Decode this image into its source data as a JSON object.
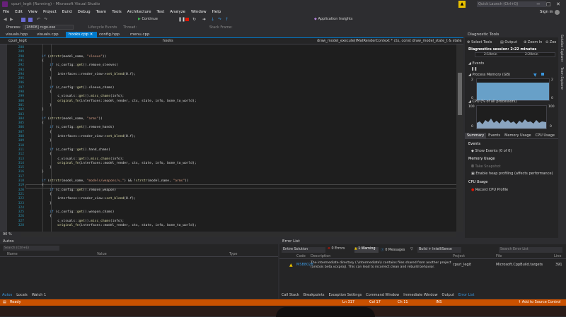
{
  "window": {
    "title": "cpuri_legit (Running) - Microsoft Visual Studio",
    "quick_launch": "Quick Launch (Ctrl+Q)",
    "sign_in": "Sign in"
  },
  "menu": [
    "File",
    "Edit",
    "View",
    "Project",
    "Build",
    "Debug",
    "Team",
    "Tools",
    "Architecture",
    "Test",
    "Analyze",
    "Window",
    "Help"
  ],
  "toolbar": {
    "continue_label": "Continue",
    "app_insights": "Application Insights",
    "process_label": "Process:",
    "process_value": "[18808] csgo.exe",
    "lifecycle_label": "Lifecycle Events",
    "thread_label": "Thread:",
    "stack_label": "Stack Frame:"
  },
  "tabs": [
    {
      "label": "visuals.hpp"
    },
    {
      "label": "visuals.cpp"
    },
    {
      "label": "hooks.cpp",
      "active": true
    },
    {
      "label": "config.hpp"
    },
    {
      "label": "menu.cpp"
    }
  ],
  "navbar": {
    "project": "cpuri_legit",
    "scope": "hooks",
    "function": "draw_model_execute(IMatRenderContext * ctx, const draw_model_state_t & state, const model_render_info_t & info, matrix3x4_t * matrix)"
  },
  "code_lines": [
    {
      "n": "288",
      "t": ""
    },
    {
      "n": "289",
      "t": ""
    },
    {
      "n": "290",
      "t": "    if (strstr(model_name, \"sleeve\"))"
    },
    {
      "n": "291",
      "t": "    {"
    },
    {
      "n": "292",
      "t": "        if (c_config::get().remove_sleeves)"
    },
    {
      "n": "293",
      "t": "        {"
    },
    {
      "n": "294",
      "t": "            interfaces::render_view->set_blend(0.f);"
    },
    {
      "n": "295",
      "t": "        }"
    },
    {
      "n": "296",
      "t": ""
    },
    {
      "n": "297",
      "t": "        if (c_config::get().sleeve_chams)"
    },
    {
      "n": "298",
      "t": "        {"
    },
    {
      "n": "299",
      "t": "            c_visuals::get().misc_chams(info);"
    },
    {
      "n": "300",
      "t": "            original_fn(interfaces::model_render, ctx, state, info, bone_to_world);"
    },
    {
      "n": "301",
      "t": "        }"
    },
    {
      "n": "302",
      "t": "    }"
    },
    {
      "n": "303",
      "t": ""
    },
    {
      "n": "304",
      "t": "    if (strstr(model_name, \"arms\"))"
    },
    {
      "n": "305",
      "t": "    {"
    },
    {
      "n": "306",
      "t": "        if (c_config::get().remove_hands)"
    },
    {
      "n": "307",
      "t": "        {"
    },
    {
      "n": "308",
      "t": "            interfaces::render_view->set_blend(0.f);"
    },
    {
      "n": "309",
      "t": "        }"
    },
    {
      "n": "310",
      "t": ""
    },
    {
      "n": "311",
      "t": "        if (c_config::get().hand_chams)"
    },
    {
      "n": "312",
      "t": "        {"
    },
    {
      "n": "313",
      "t": "            c_visuals::get().misc_chams(info);"
    },
    {
      "n": "314",
      "t": "            original_fn(interfaces::model_render, ctx, state, info, bone_to_world);"
    },
    {
      "n": "315",
      "t": "        }"
    },
    {
      "n": "316",
      "t": "    }"
    },
    {
      "n": "317",
      "t": ""
    },
    {
      "n": "318",
      "t": "    if (strstr(model_name, \"models/weapons/v_\") && !strstr(model_name, \"arms\"))"
    },
    {
      "n": "319",
      "t": "    {"
    },
    {
      "n": "320",
      "t": "        if (c_config::get().remove_weapon)"
    },
    {
      "n": "321",
      "t": "        {"
    },
    {
      "n": "322",
      "t": "            interfaces::render_view->set_blend(0.f);"
    },
    {
      "n": "323",
      "t": "        }"
    },
    {
      "n": "324",
      "t": ""
    },
    {
      "n": "325",
      "t": "        if (c_config::get().weapon_chams)"
    },
    {
      "n": "326",
      "t": "        {"
    },
    {
      "n": "327",
      "t": "            c_visuals::get().misc_chams(info);"
    },
    {
      "n": "328",
      "t": "            original_fn(interfaces::model_render, ctx, state, info, bone_to_world);"
    }
  ],
  "zoom": "90 %",
  "diagnostics": {
    "title": "Diagnostic Tools",
    "select_tools": "Select Tools",
    "output": "Output",
    "zoom_in": "Zoom In",
    "zoom_out": "Zoo",
    "session": "Diagnostics session: 2:22 minutes",
    "t1": "2:10min",
    "t2": "2:20min",
    "events": "Events",
    "process_memory": "Process Memory (GB)",
    "mem_max": "2",
    "mem_min": "0",
    "cpu": "CPU (% of all processors)",
    "cpu_max": "100",
    "cpu_min": "0",
    "tabs": [
      "Summary",
      "Events",
      "Memory Usage",
      "CPU Usage"
    ],
    "events_header": "Events",
    "show_events": "Show Events (0 of 0)",
    "memory_usage": "Memory Usage",
    "take_snapshot": "Take Snapshot",
    "heap_profiling": "Enable heap profiling (affects performance)",
    "cpu_usage": "CPU Usage",
    "record_cpu": "Record CPU Profile",
    "side_tabs": [
      "Solution Explorer",
      "Team Explorer"
    ]
  },
  "autos": {
    "title": "Autos",
    "search_placeholder": "Search (Ctrl+E)",
    "columns": [
      "Name",
      "Value",
      "Type"
    ],
    "bottom_tabs": [
      "Autos",
      "Locals",
      "Watch 1"
    ]
  },
  "error_list": {
    "title": "Error List",
    "scope": "Entire Solution",
    "errors": "0 Errors",
    "warnings": "1 Warning",
    "messages": "0 Messages",
    "build_filter": "Build + IntelliSense",
    "search_placeholder": "Search Error List",
    "columns": [
      "Code",
      "Description",
      "Project",
      "File",
      "Line"
    ],
    "row": {
      "code": "MSB8028",
      "description": "The intermediate directory (.\\Intermediate\\) contains files shared from another project (aristois beta.vcxproj). This can lead to incorrect clean and rebuild behavior.",
      "project": "cpuri_legit",
      "file": "Microsoft.CppBuild.targets",
      "line": "391"
    },
    "bottom_tabs": [
      "Call Stack",
      "Breakpoints",
      "Exception Settings",
      "Command Window",
      "Immediate Window",
      "Output",
      "Error List"
    ]
  },
  "status": {
    "ready": "Ready",
    "ln": "Ln 317",
    "col": "Col 17",
    "ch": "Ch 11",
    "mode": "INS",
    "source_control": "Add to Source Control"
  },
  "colors": {
    "accent": "#007acc",
    "status_debug": "#ca5100"
  }
}
